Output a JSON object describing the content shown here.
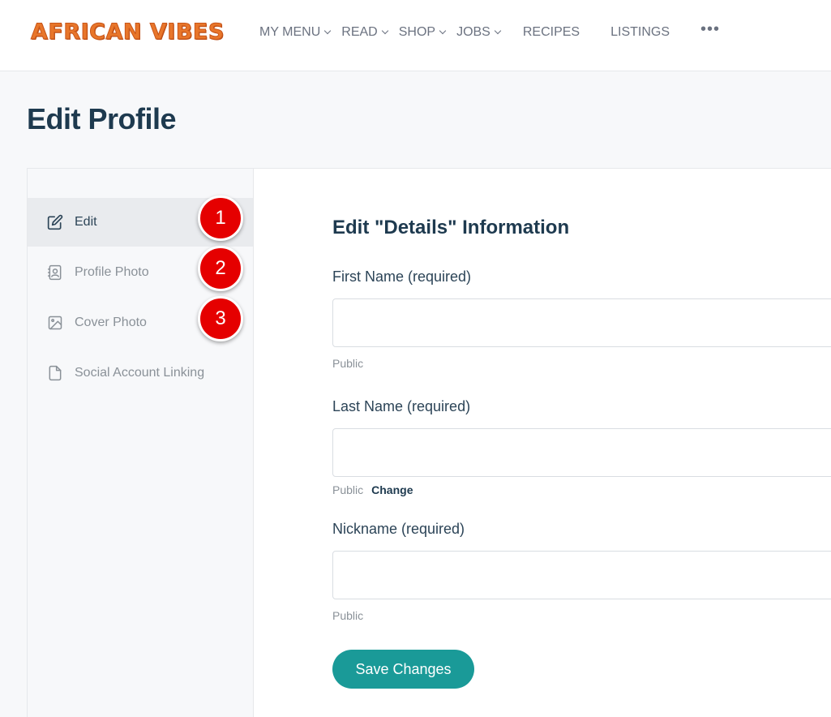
{
  "header": {
    "logo": "AFRICAN VIBES",
    "nav": [
      {
        "label": "MY MENU",
        "dropdown": true
      },
      {
        "label": "READ",
        "dropdown": true
      },
      {
        "label": "SHOP",
        "dropdown": true
      },
      {
        "label": "JOBS",
        "dropdown": true
      },
      {
        "label": "RECIPES",
        "dropdown": false
      },
      {
        "label": "LISTINGS",
        "dropdown": false
      }
    ],
    "more": "•••"
  },
  "page": {
    "title": "Edit Profile"
  },
  "sidebar": {
    "items": [
      {
        "label": "Edit",
        "icon": "edit-icon",
        "active": true,
        "badge": "1"
      },
      {
        "label": "Profile Photo",
        "icon": "contact-card-icon",
        "active": false,
        "badge": "2"
      },
      {
        "label": "Cover Photo",
        "icon": "image-icon",
        "active": false,
        "badge": "3"
      },
      {
        "label": "Social Account Linking",
        "icon": "document-icon",
        "active": false
      }
    ]
  },
  "form": {
    "section_title": "Edit \"Details\" Information",
    "fields": [
      {
        "label": "First Name (required)",
        "value": "",
        "visibility": "Public"
      },
      {
        "label": "Last Name (required)",
        "value": "",
        "visibility": "Public",
        "change": "Change"
      },
      {
        "label": "Nickname (required)",
        "value": "",
        "visibility": "Public"
      }
    ],
    "save_label": "Save Changes"
  },
  "colors": {
    "brand": "#e8762a",
    "accent": "#1a9a98",
    "badge": "#e50000",
    "title": "#1e3a4f"
  }
}
